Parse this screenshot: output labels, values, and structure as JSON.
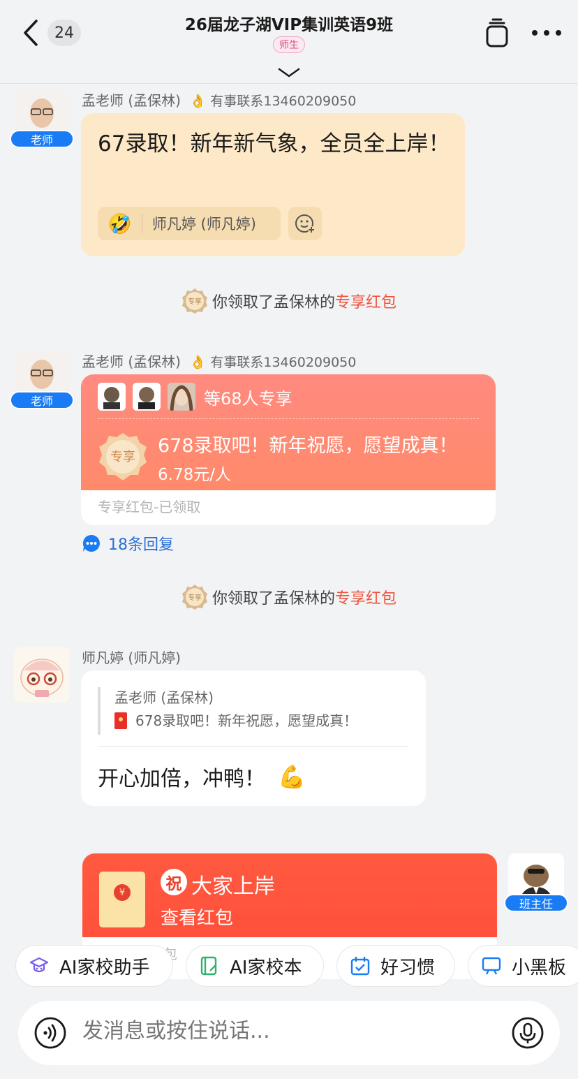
{
  "header": {
    "unread_count": "24",
    "title": "26届龙子湖VIP集训英语9班",
    "role_tag": "师生"
  },
  "messages": {
    "m1": {
      "sender": "孟老师 (孟保林)",
      "note": "👌 有事联系13460209050",
      "role": "老师",
      "text": "67录取！新年新气象，全员全上岸！",
      "reaction_emoji": "🤣",
      "reaction_user": "师凡婷 (师凡婷)"
    },
    "sys1": {
      "prefix": "你领取了孟保林的",
      "link": "专享红包",
      "coin": "专享"
    },
    "m2": {
      "sender": "孟老师 (孟保林)",
      "note": "👌 有事联系13460209050",
      "role": "老师",
      "shared_text": "等68人专享",
      "seal": "专享",
      "title": "678录取吧！新年祝愿，愿望成真！",
      "amount": "6.78元/人",
      "footer": "专享红包-已领取",
      "replies": "18条回复"
    },
    "sys2": {
      "prefix": "你领取了孟保林的",
      "link": "专享红包",
      "coin": "专享"
    },
    "m3": {
      "sender": "师凡婷 (师凡婷)",
      "quote_author": "孟老师 (孟保林)",
      "quote_text": "678录取吧！新年祝愿，愿望成真！",
      "text": "开心加倍，冲鸭！",
      "emoji": "💪"
    },
    "m4": {
      "role": "班主任",
      "zhu": "祝",
      "title": "大家上岸",
      "action": "查看红包",
      "footer": "包",
      "yen": "¥"
    }
  },
  "quick_actions": [
    {
      "label": "AI家校助手",
      "icon": "ai-assistant-icon"
    },
    {
      "label": "AI家校本",
      "icon": "notebook-icon"
    },
    {
      "label": "好习惯",
      "icon": "calendar-check-icon"
    },
    {
      "label": "小黑板",
      "icon": "blackboard-icon"
    }
  ],
  "input": {
    "placeholder": "发消息或按住说话..."
  },
  "colors": {
    "accent": "#1a7cf4",
    "red_packet": "#ff8a80",
    "highlight": "#f0533c"
  }
}
